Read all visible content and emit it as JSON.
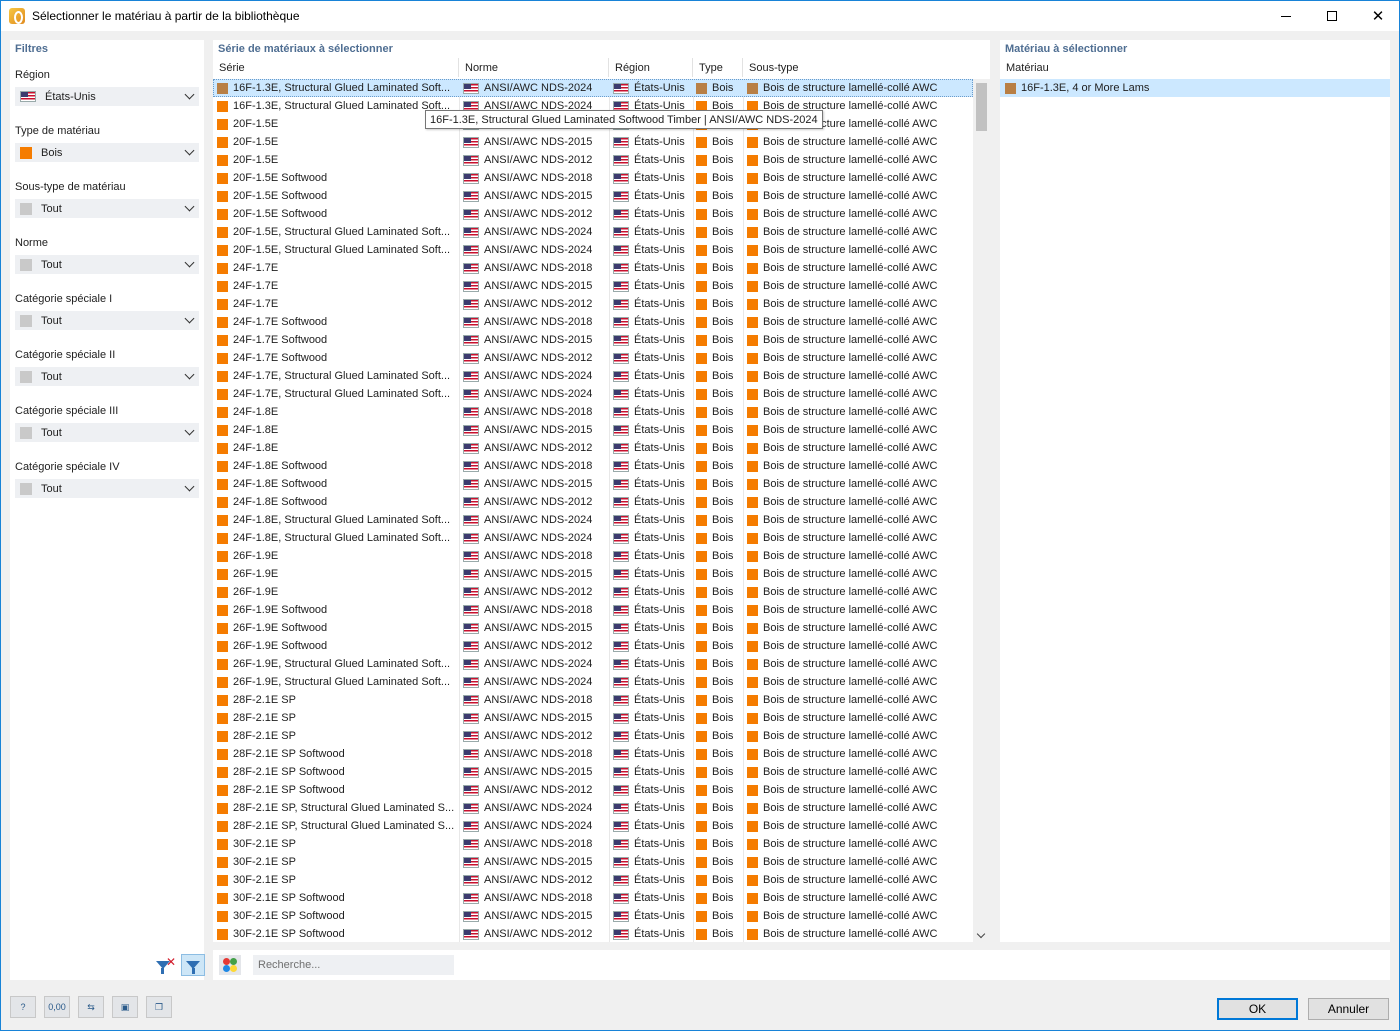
{
  "window": {
    "title": "Sélectionner le matériau à partir de la bibliothèque",
    "minimize": "—",
    "close": "✕"
  },
  "colors": {
    "accent": "#1883d7",
    "timber": "#f57c00",
    "timber_selected": "#b87f45",
    "selection": "#cce8ff",
    "panel_title": "#4f6e92"
  },
  "filters": {
    "title": "Filtres",
    "items": [
      {
        "label": "Région",
        "value": "États-Unis",
        "icon": "us-flag-icon"
      },
      {
        "label": "Type de matériau",
        "value": "Bois",
        "icon": "orange-square-icon"
      },
      {
        "label": "Sous-type de matériau",
        "value": "Tout",
        "icon": "gray-square-icon"
      },
      {
        "label": "Norme",
        "value": "Tout",
        "icon": "gray-square-icon"
      },
      {
        "label": "Catégorie spéciale I",
        "value": "Tout",
        "icon": "gray-square-icon"
      },
      {
        "label": "Catégorie spéciale II",
        "value": "Tout",
        "icon": "gray-square-icon"
      },
      {
        "label": "Catégorie spéciale III",
        "value": "Tout",
        "icon": "gray-square-icon"
      },
      {
        "label": "Catégorie spéciale IV",
        "value": "Tout",
        "icon": "gray-square-icon"
      }
    ]
  },
  "series": {
    "title": "Série de matériaux à sélectionner",
    "columns": [
      "Série",
      "Norme",
      "Région",
      "Type",
      "Sous-type"
    ],
    "tooltip": "16F-1.3E, Structural Glued Laminated Softwood Timber | ANSI/AWC NDS-2024",
    "region": "États-Unis",
    "type": "Bois",
    "subtype": "Bois de structure lamellé-collé AWC",
    "rows": [
      {
        "serie": "16F-1.3E, Structural Glued Laminated Soft...",
        "norme": "ANSI/AWC NDS-2024",
        "selected": true
      },
      {
        "serie": "16F-1.3E, Structural Glued Laminated Soft...",
        "norme": "ANSI/AWC NDS-2024"
      },
      {
        "serie": "20F-1.5E",
        "norme": "ANSI/AWC NDS-2018"
      },
      {
        "serie": "20F-1.5E",
        "norme": "ANSI/AWC NDS-2015"
      },
      {
        "serie": "20F-1.5E",
        "norme": "ANSI/AWC NDS-2012"
      },
      {
        "serie": "20F-1.5E Softwood",
        "norme": "ANSI/AWC NDS-2018"
      },
      {
        "serie": "20F-1.5E Softwood",
        "norme": "ANSI/AWC NDS-2015"
      },
      {
        "serie": "20F-1.5E Softwood",
        "norme": "ANSI/AWC NDS-2012"
      },
      {
        "serie": "20F-1.5E, Structural Glued Laminated Soft...",
        "norme": "ANSI/AWC NDS-2024"
      },
      {
        "serie": "20F-1.5E, Structural Glued Laminated Soft...",
        "norme": "ANSI/AWC NDS-2024"
      },
      {
        "serie": "24F-1.7E",
        "norme": "ANSI/AWC NDS-2018"
      },
      {
        "serie": "24F-1.7E",
        "norme": "ANSI/AWC NDS-2015"
      },
      {
        "serie": "24F-1.7E",
        "norme": "ANSI/AWC NDS-2012"
      },
      {
        "serie": "24F-1.7E Softwood",
        "norme": "ANSI/AWC NDS-2018"
      },
      {
        "serie": "24F-1.7E Softwood",
        "norme": "ANSI/AWC NDS-2015"
      },
      {
        "serie": "24F-1.7E Softwood",
        "norme": "ANSI/AWC NDS-2012"
      },
      {
        "serie": "24F-1.7E, Structural Glued Laminated Soft...",
        "norme": "ANSI/AWC NDS-2024"
      },
      {
        "serie": "24F-1.7E, Structural Glued Laminated Soft...",
        "norme": "ANSI/AWC NDS-2024"
      },
      {
        "serie": "24F-1.8E",
        "norme": "ANSI/AWC NDS-2018"
      },
      {
        "serie": "24F-1.8E",
        "norme": "ANSI/AWC NDS-2015"
      },
      {
        "serie": "24F-1.8E",
        "norme": "ANSI/AWC NDS-2012"
      },
      {
        "serie": "24F-1.8E Softwood",
        "norme": "ANSI/AWC NDS-2018"
      },
      {
        "serie": "24F-1.8E Softwood",
        "norme": "ANSI/AWC NDS-2015"
      },
      {
        "serie": "24F-1.8E Softwood",
        "norme": "ANSI/AWC NDS-2012"
      },
      {
        "serie": "24F-1.8E, Structural Glued Laminated Soft...",
        "norme": "ANSI/AWC NDS-2024"
      },
      {
        "serie": "24F-1.8E, Structural Glued Laminated Soft...",
        "norme": "ANSI/AWC NDS-2024"
      },
      {
        "serie": "26F-1.9E",
        "norme": "ANSI/AWC NDS-2018"
      },
      {
        "serie": "26F-1.9E",
        "norme": "ANSI/AWC NDS-2015"
      },
      {
        "serie": "26F-1.9E",
        "norme": "ANSI/AWC NDS-2012"
      },
      {
        "serie": "26F-1.9E Softwood",
        "norme": "ANSI/AWC NDS-2018"
      },
      {
        "serie": "26F-1.9E Softwood",
        "norme": "ANSI/AWC NDS-2015"
      },
      {
        "serie": "26F-1.9E Softwood",
        "norme": "ANSI/AWC NDS-2012"
      },
      {
        "serie": "26F-1.9E, Structural Glued Laminated Soft...",
        "norme": "ANSI/AWC NDS-2024"
      },
      {
        "serie": "26F-1.9E, Structural Glued Laminated Soft...",
        "norme": "ANSI/AWC NDS-2024"
      },
      {
        "serie": "28F-2.1E SP",
        "norme": "ANSI/AWC NDS-2018"
      },
      {
        "serie": "28F-2.1E SP",
        "norme": "ANSI/AWC NDS-2015"
      },
      {
        "serie": "28F-2.1E SP",
        "norme": "ANSI/AWC NDS-2012"
      },
      {
        "serie": "28F-2.1E SP Softwood",
        "norme": "ANSI/AWC NDS-2018"
      },
      {
        "serie": "28F-2.1E SP Softwood",
        "norme": "ANSI/AWC NDS-2015"
      },
      {
        "serie": "28F-2.1E SP Softwood",
        "norme": "ANSI/AWC NDS-2012"
      },
      {
        "serie": "28F-2.1E SP, Structural Glued Laminated S...",
        "norme": "ANSI/AWC NDS-2024"
      },
      {
        "serie": "28F-2.1E SP, Structural Glued Laminated S...",
        "norme": "ANSI/AWC NDS-2024"
      },
      {
        "serie": "30F-2.1E SP",
        "norme": "ANSI/AWC NDS-2018"
      },
      {
        "serie": "30F-2.1E SP",
        "norme": "ANSI/AWC NDS-2015"
      },
      {
        "serie": "30F-2.1E SP",
        "norme": "ANSI/AWC NDS-2012"
      },
      {
        "serie": "30F-2.1E SP Softwood",
        "norme": "ANSI/AWC NDS-2018"
      },
      {
        "serie": "30F-2.1E SP Softwood",
        "norme": "ANSI/AWC NDS-2015"
      },
      {
        "serie": "30F-2.1E SP Softwood",
        "norme": "ANSI/AWC NDS-2012"
      }
    ]
  },
  "search": {
    "placeholder": "Recherche..."
  },
  "selected_material": {
    "title": "Matériau à sélectionner",
    "column": "Matériau",
    "item": "16F-1.3E, 4 or More Lams"
  },
  "footer": {
    "tools": [
      "help-icon",
      "units-icon",
      "previous-icon",
      "save-icon",
      "copy-icon"
    ],
    "units_text": "0,00",
    "ok": "OK",
    "cancel": "Annuler"
  }
}
